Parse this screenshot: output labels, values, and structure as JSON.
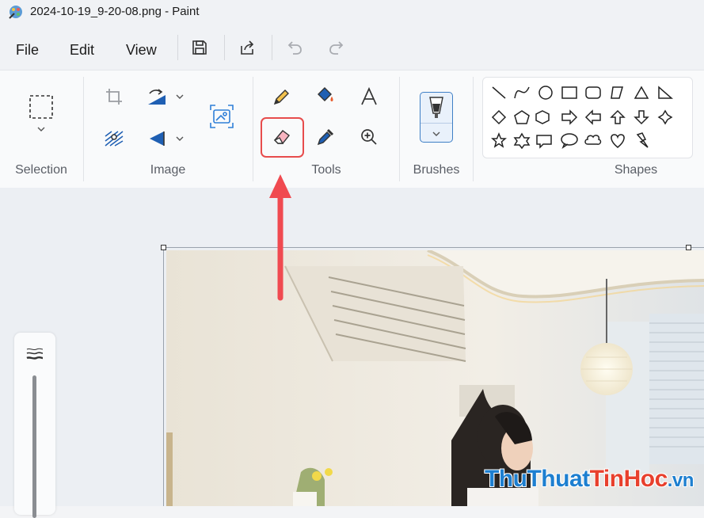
{
  "window": {
    "title": "2024-10-19_9-20-08.png - Paint"
  },
  "menu": {
    "file": "File",
    "edit": "Edit",
    "view": "View"
  },
  "quick_access": [
    "save-icon",
    "share-icon",
    "undo-icon",
    "redo-icon"
  ],
  "ribbon": {
    "groups": {
      "selection": "Selection",
      "image": "Image",
      "tools": "Tools",
      "brushes": "Brushes",
      "shapes": "Shapes"
    }
  },
  "shapes": [
    "line",
    "curve",
    "oval",
    "rectangle",
    "rounded-rectangle",
    "polygon",
    "triangle",
    "right-triangle",
    "diamond",
    "pentagon",
    "hexagon",
    "right-arrow",
    "left-arrow",
    "up-arrow",
    "down-arrow",
    "four-point-star",
    "five-point-star",
    "six-point-star",
    "rounded-callout",
    "oval-callout",
    "cloud-callout",
    "heart",
    "lightning"
  ],
  "watermark": {
    "part1": "ThuThuat",
    "part2": "TinHoc",
    "part3": ".vn"
  },
  "colors": {
    "accent": "#3f7fc6",
    "highlight": "#e74c4c",
    "arrow": "#f04a50"
  }
}
